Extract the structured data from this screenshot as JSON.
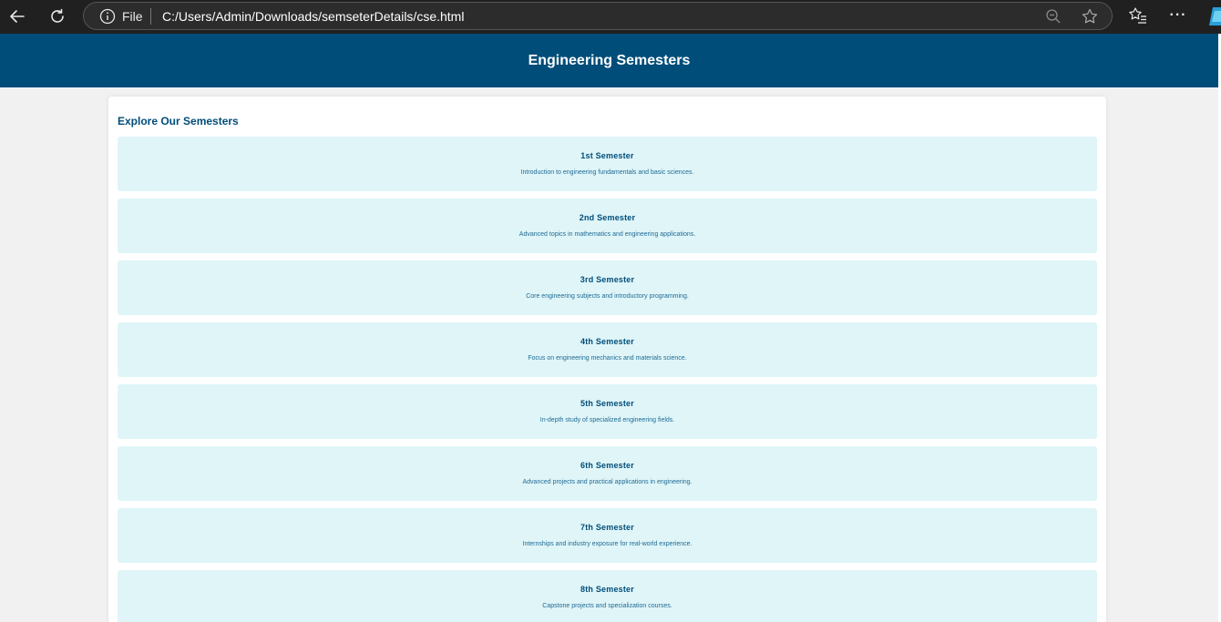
{
  "browser": {
    "scheme_label": "File",
    "url": "C:/Users/Admin/Downloads/semseterDetails/cse.html"
  },
  "header": {
    "title": "Engineering Semesters"
  },
  "main": {
    "section_title": "Explore Our Semesters",
    "semesters": [
      {
        "title": "1st Semester",
        "description": "Introduction to engineering fundamentals and basic sciences."
      },
      {
        "title": "2nd Semester",
        "description": "Advanced topics in mathematics and engineering applications."
      },
      {
        "title": "3rd Semester",
        "description": "Core engineering subjects and introductory programming."
      },
      {
        "title": "4th Semester",
        "description": "Focus on engineering mechanics and materials science."
      },
      {
        "title": "5th Semester",
        "description": "In-depth study of specialized engineering fields."
      },
      {
        "title": "6th Semester",
        "description": "Advanced projects and practical applications in engineering."
      },
      {
        "title": "7th Semester",
        "description": "Internships and industry exposure for real-world experience."
      },
      {
        "title": "8th Semester",
        "description": "Capstone projects and specialization courses."
      }
    ]
  },
  "colors": {
    "header_bg": "#004d79",
    "card_bg": "#dff5f8",
    "title_text": "#004d79"
  }
}
